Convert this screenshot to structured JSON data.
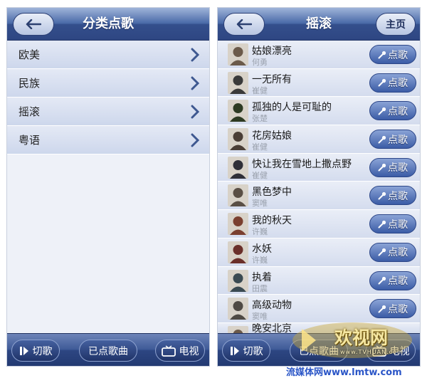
{
  "left_screen": {
    "header": {
      "title": "分类点歌"
    },
    "categories": [
      {
        "label": "欧美"
      },
      {
        "label": "民族"
      },
      {
        "label": "摇滚"
      },
      {
        "label": "粤语"
      }
    ],
    "footer": {
      "next_label": "切歌",
      "queue_label": "已点歌曲",
      "tv_label": "电视"
    }
  },
  "right_screen": {
    "header": {
      "title": "摇滚",
      "home_label": "主页"
    },
    "request_label": "点歌",
    "songs": [
      {
        "title": "姑娘漂亮",
        "artist": "何勇"
      },
      {
        "title": "一无所有",
        "artist": "崔健"
      },
      {
        "title": "孤独的人是可耻的",
        "artist": "张楚"
      },
      {
        "title": "花房姑娘",
        "artist": "崔健"
      },
      {
        "title": "快让我在雪地上撒点野",
        "artist": "崔健"
      },
      {
        "title": "黑色梦中",
        "artist": "窦唯"
      },
      {
        "title": "我的秋天",
        "artist": "许巍"
      },
      {
        "title": "水妖",
        "artist": "许巍"
      },
      {
        "title": "执着",
        "artist": "田震"
      },
      {
        "title": "高级动物",
        "artist": "窦唯"
      },
      {
        "title": "晚安北京",
        "artist": ""
      }
    ],
    "footer": {
      "next_label": "切歌",
      "queue_label": "已点歌曲",
      "tv_label": "电视"
    }
  },
  "watermark": {
    "logo_text": "欢视网",
    "logo_url": "www.TVHUAN.com",
    "bottom_text": "流媒体网www.lmtw.com"
  },
  "colors": {
    "header_blue": "#344f8c",
    "row_blue": "#d4dcee",
    "button_blue": "#3b5ca6",
    "watermark_blue": "#2a55c7"
  }
}
